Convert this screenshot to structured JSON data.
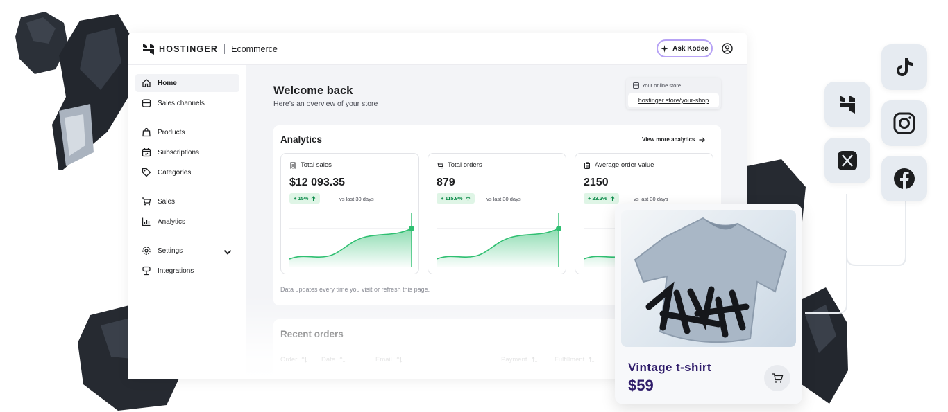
{
  "header": {
    "brand": "HOSTINGER",
    "product": "Ecommerce",
    "ask_button": "Ask Kodee"
  },
  "sidebar": {
    "items": [
      {
        "label": "Home",
        "icon": "home-icon",
        "active": true
      },
      {
        "label": "Sales channels",
        "icon": "store-icon"
      },
      {
        "label": "Products",
        "icon": "bag-icon"
      },
      {
        "label": "Subscriptions",
        "icon": "calendar-icon"
      },
      {
        "label": "Categories",
        "icon": "tag-icon"
      },
      {
        "label": "Sales",
        "icon": "cart-icon"
      },
      {
        "label": "Analytics",
        "icon": "bar-chart-icon"
      },
      {
        "label": "Settings",
        "icon": "gear-icon"
      },
      {
        "label": "Integrations",
        "icon": "integrations-icon"
      }
    ]
  },
  "main": {
    "welcome": "Welcome back",
    "overview": "Here’s an overview of your store",
    "store": {
      "label": "Your online store",
      "url": "hostinger.store/your-shop"
    },
    "analytics": {
      "title": "Analytics",
      "view_more": "View more analytics",
      "metrics": [
        {
          "label": "Total sales",
          "value": "$12 093.35",
          "change": "+ 15%",
          "compare": "vs last 30 days",
          "icon": "receipt-icon"
        },
        {
          "label": "Total orders",
          "value": "879",
          "change": "+ 115.9%",
          "compare": "vs last 30 days",
          "icon": "cart-icon"
        },
        {
          "label": "Average order value",
          "value": "2150",
          "change": "+ 23.2%",
          "compare": "vs last 30 days",
          "icon": "clipboard-icon"
        }
      ],
      "footnote": "Data updates every time you visit or refresh this page."
    },
    "orders": {
      "title": "Recent orders",
      "columns": [
        "Order",
        "Date",
        "Email",
        "Payment",
        "Fulfillment"
      ]
    }
  },
  "product_card": {
    "name": "Vintage t-shirt",
    "price": "$59"
  },
  "social": [
    "hostinger-icon",
    "tiktok-icon",
    "instagram-icon",
    "x-icon",
    "facebook-icon"
  ],
  "colors": {
    "accent_green": "#2fbf71",
    "badge_text": "#0a8a48",
    "ask_border": "#b7a3f5",
    "product_text": "#2f1c6a"
  }
}
